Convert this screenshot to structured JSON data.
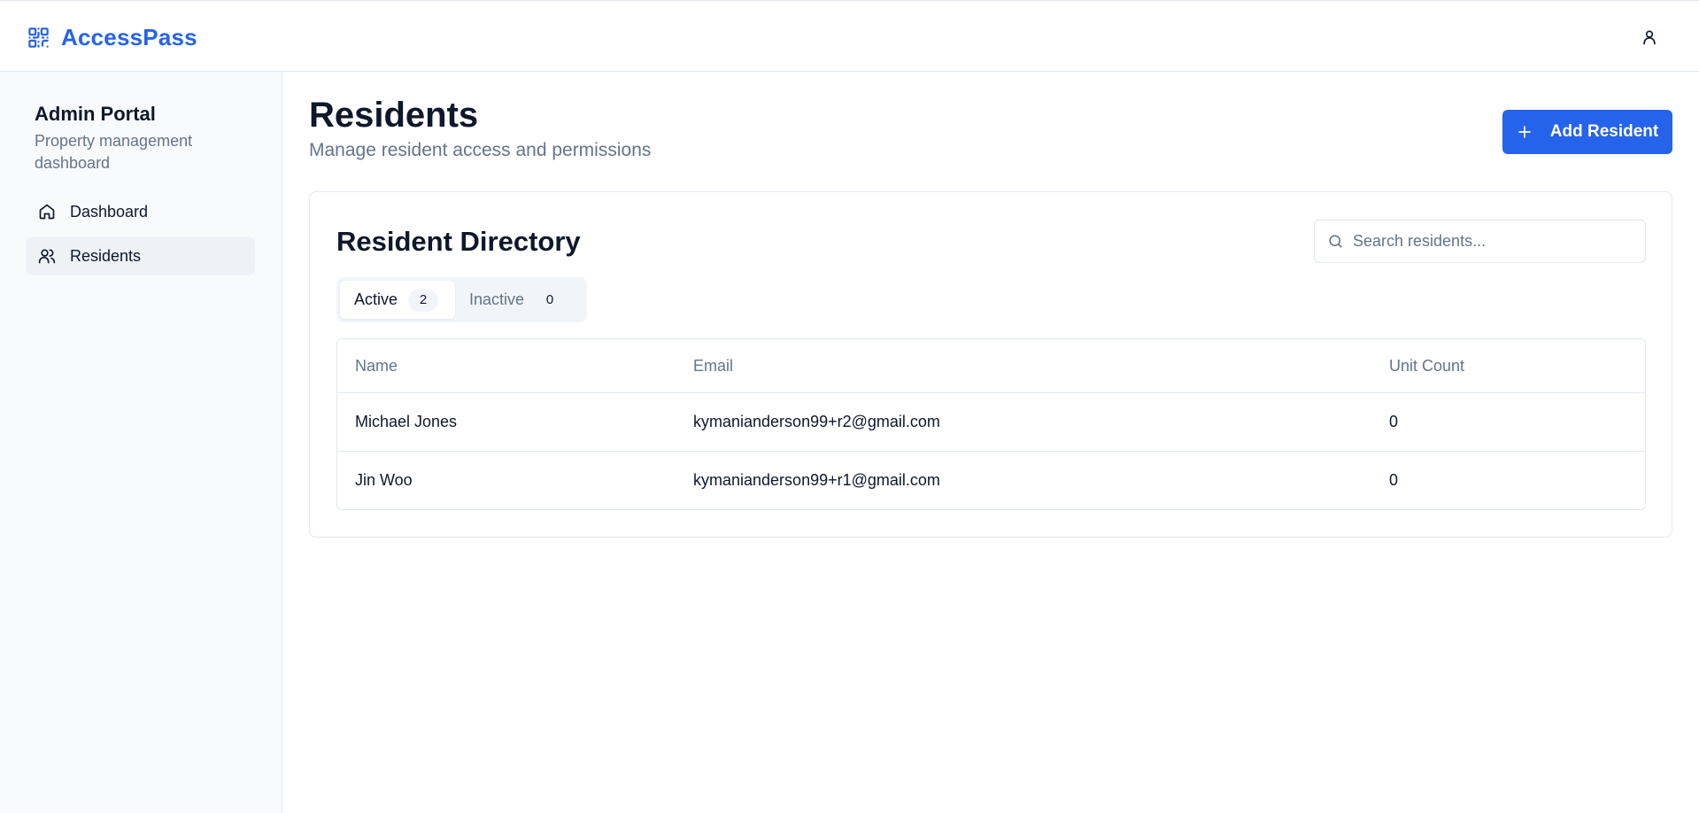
{
  "app": {
    "name": "AccessPass",
    "brand_color": "#2563eb",
    "logo_icon": "qr-code-icon",
    "user_icon": "user-icon"
  },
  "sidebar": {
    "title": "Admin Portal",
    "subtitle": "Property management dashboard",
    "items": [
      {
        "label": "Dashboard",
        "icon": "home-icon",
        "active": false
      },
      {
        "label": "Residents",
        "icon": "users-icon",
        "active": true
      }
    ]
  },
  "page": {
    "title": "Residents",
    "subtitle": "Manage resident access and permissions",
    "add_button_label": "Add Resident"
  },
  "directory": {
    "title": "Resident Directory",
    "search_placeholder": "Search residents...",
    "search_value": "",
    "tabs": [
      {
        "label": "Active",
        "count": "2",
        "selected": true
      },
      {
        "label": "Inactive",
        "count": "0",
        "selected": false
      }
    ],
    "columns": [
      "Name",
      "Email",
      "Unit Count"
    ],
    "rows": [
      {
        "name": "Michael Jones",
        "email": "kymanianderson99+r2@gmail.com",
        "units": "0"
      },
      {
        "name": "Jin Woo",
        "email": "kymanianderson99+r1@gmail.com",
        "units": "0"
      }
    ]
  }
}
